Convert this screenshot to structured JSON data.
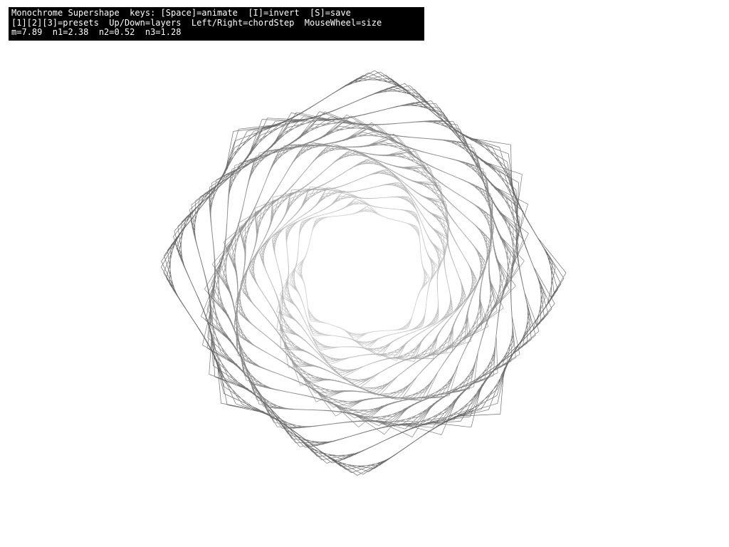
{
  "hud": {
    "line1": "Monochrome Supershape  keys: [Space]=animate  [I]=invert  [S]=save",
    "line2": "[1][2][3]=presets  Up/Down=layers  Left/Right=chordStep  MouseWheel=size",
    "line3": "m=7.89  n1=2.38  n2=0.52  n3=1.28"
  },
  "params": {
    "m": 7.89,
    "n1": 2.38,
    "n2": 0.52,
    "n3": 1.28
  },
  "colors": {
    "background": "#ffffff",
    "hud_background": "#000000",
    "hud_text": "#ffffff",
    "stroke_outer": "#555555",
    "stroke_inner": "#c8c8c8"
  }
}
